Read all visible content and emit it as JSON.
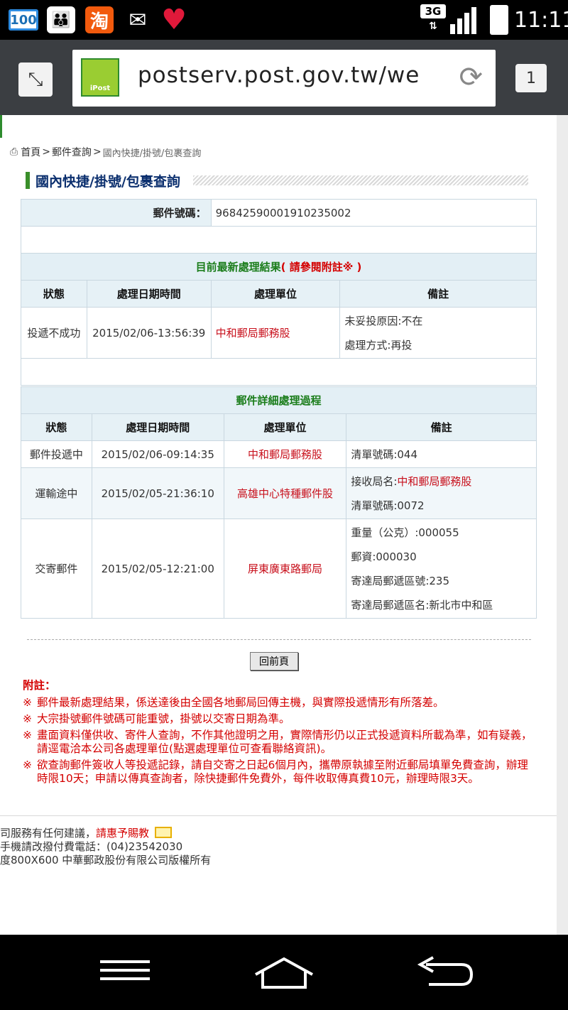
{
  "status_bar": {
    "battery_level": "100",
    "taobao_label": "淘",
    "network": "3G",
    "time": "11:11"
  },
  "browser": {
    "url": "postserv.post.gov.tw/we",
    "favicon_label": "iPost",
    "tab_count": "1"
  },
  "breadcrumb": {
    "home": "首頁",
    "sep1": ">",
    "mail_query": "郵件查詢",
    "sep2": ">",
    "current": "國內快捷/掛號/包裹查詢"
  },
  "page_title": "國內快捷/掛號/包裹查詢",
  "tracking": {
    "label": "郵件號碼：",
    "number": "96842590001910235002"
  },
  "latest_result": {
    "title": "目前最新處理結果",
    "note": "( 請參閱附註※ )",
    "headers": [
      "狀態",
      "處理日期時間",
      "處理單位",
      "備註"
    ],
    "row": {
      "status": "投遞不成功",
      "datetime": "2015/02/06-13:56:39",
      "unit": "中和郵局郵務股",
      "memo": [
        "未妥投原因:不在",
        "處理方式:再投"
      ]
    }
  },
  "details": {
    "title": "郵件詳細處理過程",
    "headers": [
      "狀態",
      "處理日期時間",
      "處理單位",
      "備註"
    ],
    "rows": [
      {
        "status": "郵件投遞中",
        "datetime": "2015/02/06-09:14:35",
        "unit": "中和郵局郵務股",
        "memo": [
          "清單號碼:044"
        ]
      },
      {
        "status": "運輸途中",
        "datetime": "2015/02/05-21:36:10",
        "unit": "高雄中心特種郵件股",
        "memo_prefix": "接收局名:",
        "memo_link": "中和郵局郵務股",
        "memo": [
          "清單號碼:0072"
        ]
      },
      {
        "status": "交寄郵件",
        "datetime": "2015/02/05-12:21:00",
        "unit": "屏東廣東路郵局",
        "memo": [
          "重量（公克）:000055",
          "郵資:000030",
          "寄達局郵遞區號:235",
          "寄達局郵遞區名:新北市中和區"
        ]
      }
    ]
  },
  "back_button": "回前頁",
  "notes": {
    "title": "附註：",
    "mark": "※",
    "items": [
      "郵件最新處理結果，係送達後由全國各地郵局回傳主機，與實際投遞情形有所落差。",
      "大宗掛號郵件號碼可能重號，掛號以交寄日期為準。",
      "畫面資料僅供收、寄件人查詢，不作其他證明之用，實際情形仍以正式投遞資料所載為準，如有疑義，請逕電洽本公司各處理單位(點選處理單位可查看聯絡資訊)。",
      "欲查詢郵件簽收人等投遞記錄，請自交寄之日起6個月內，攜帶原執據至附近郵局填單免費查詢，辦理時限10天；申請以傳真查詢者，除快捷郵件免費外，每件收取傳真費10元，辦理時限3天。"
    ]
  },
  "footer": {
    "line1": "司服務有任何建議，",
    "line1_link": "請惠予賜教",
    "line2": "手機請改撥付費電話：(04)23542030",
    "line3": "度800X600 中華郵政股份有限公司版權所有"
  },
  "colors": {
    "accent_green": "#1b7d1b",
    "link_red": "#c8101c",
    "note_red": "#d40000",
    "title_blue": "#0b2f6e"
  }
}
